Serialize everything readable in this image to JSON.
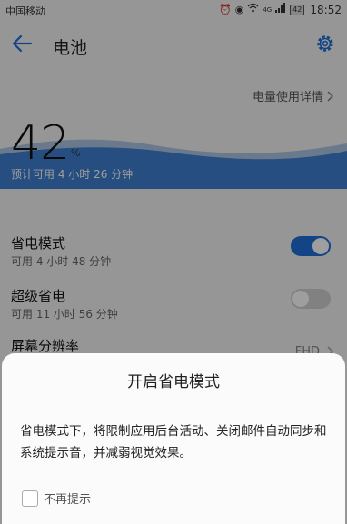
{
  "status_bar": {
    "carrier": "中国移动",
    "network": "4G",
    "battery": "42",
    "time": "18:52"
  },
  "header": {
    "title": "电池",
    "back_icon": "back-arrow-icon",
    "settings_icon": "gear-icon",
    "accent_color": "#1e6fd9"
  },
  "battery": {
    "usage_link": "电量使用详情",
    "percent": "42",
    "percent_sign": "%",
    "estimate": "预计可用 4 小时 26 分钟",
    "level": 0.42
  },
  "settings": {
    "power_saving": {
      "title": "省电模式",
      "subtitle": "可用 4 小时 48 分钟",
      "enabled": true
    },
    "ultra_saving": {
      "title": "超级省电",
      "subtitle": "可用 11 小时 56 分钟",
      "enabled": false
    },
    "resolution": {
      "title": "屏幕分辨率",
      "value": "FHD"
    }
  },
  "dialog": {
    "title": "开启省电模式",
    "body": "省电模式下，将限制应用后台活动、关闭邮件自动同步和系统提示音，并减弱视觉效果。",
    "checkbox_label": "不再提示",
    "checkbox_checked": false
  }
}
